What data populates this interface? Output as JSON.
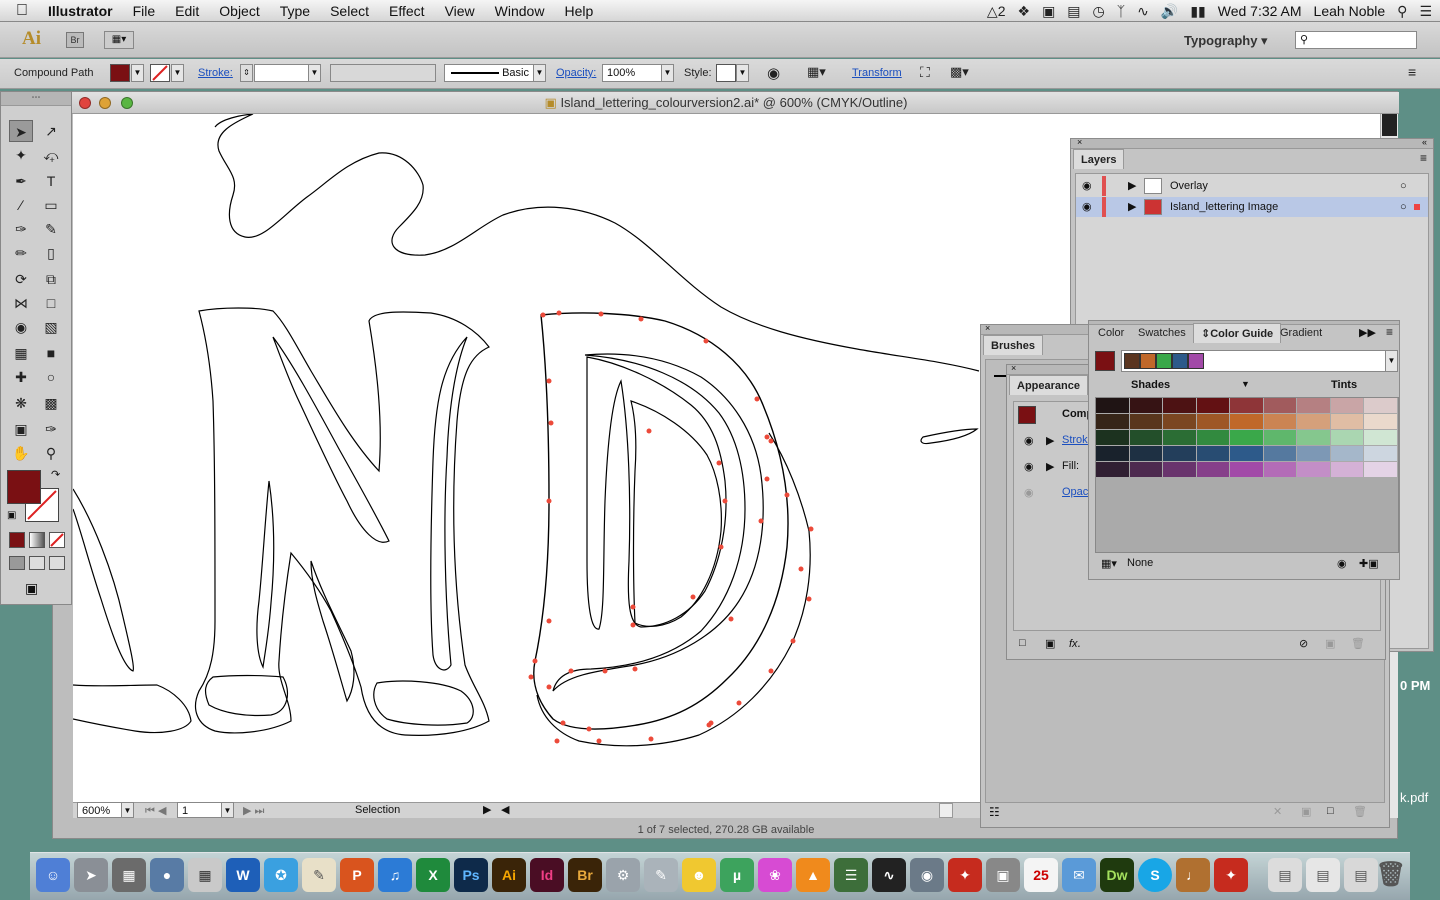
{
  "menubar": {
    "app": "Illustrator",
    "items": [
      "File",
      "Edit",
      "Object",
      "Type",
      "Select",
      "Effect",
      "View",
      "Window",
      "Help"
    ],
    "tray_ai": "2",
    "clock": "Wed 7:32 AM",
    "user": "Leah Noble"
  },
  "appbar": {
    "logo": "Ai",
    "bridge": "Br",
    "workspace": "Typography",
    "search_placeholder": ""
  },
  "control": {
    "selection_type": "Compound Path",
    "stroke_label": "Stroke:",
    "brush_label": "Basic",
    "opacity_label": "Opacity:",
    "opacity_value": "100%",
    "style_label": "Style:",
    "transform_label": "Transform",
    "fill_color": "#7a1013"
  },
  "document": {
    "title": "Island_lettering_colourversion2.ai* @ 600% (CMYK/Outline)",
    "zoom": "600%",
    "artboard": "1",
    "status_tool": "Selection",
    "availability": "1 of 7 selected, 270.28 GB available"
  },
  "layers_panel": {
    "title": "Layers",
    "layers": [
      {
        "name": "Overlay"
      },
      {
        "name": "Island_lettering Image"
      }
    ]
  },
  "brushes_panel": {
    "title": "Brushes"
  },
  "appearance_panel": {
    "title": "Appearance",
    "object": "Comp",
    "stroke": "Stroke",
    "fill": "Fill:",
    "opacity": "Opaci"
  },
  "colorguide_panel": {
    "tabs": [
      "Color",
      "Swatches",
      "Color Guide",
      "Gradient"
    ],
    "shades": "Shades",
    "tints": "Tints",
    "none": "None",
    "base_color": "#7a1013",
    "harmony": [
      "#5a3520",
      "#c0682a",
      "#3aa84a",
      "#2d5a8a",
      "#a24aa8"
    ]
  },
  "side_text": {
    "clock_fragment": "0 PM",
    "file_fragment": "k.pdf"
  }
}
